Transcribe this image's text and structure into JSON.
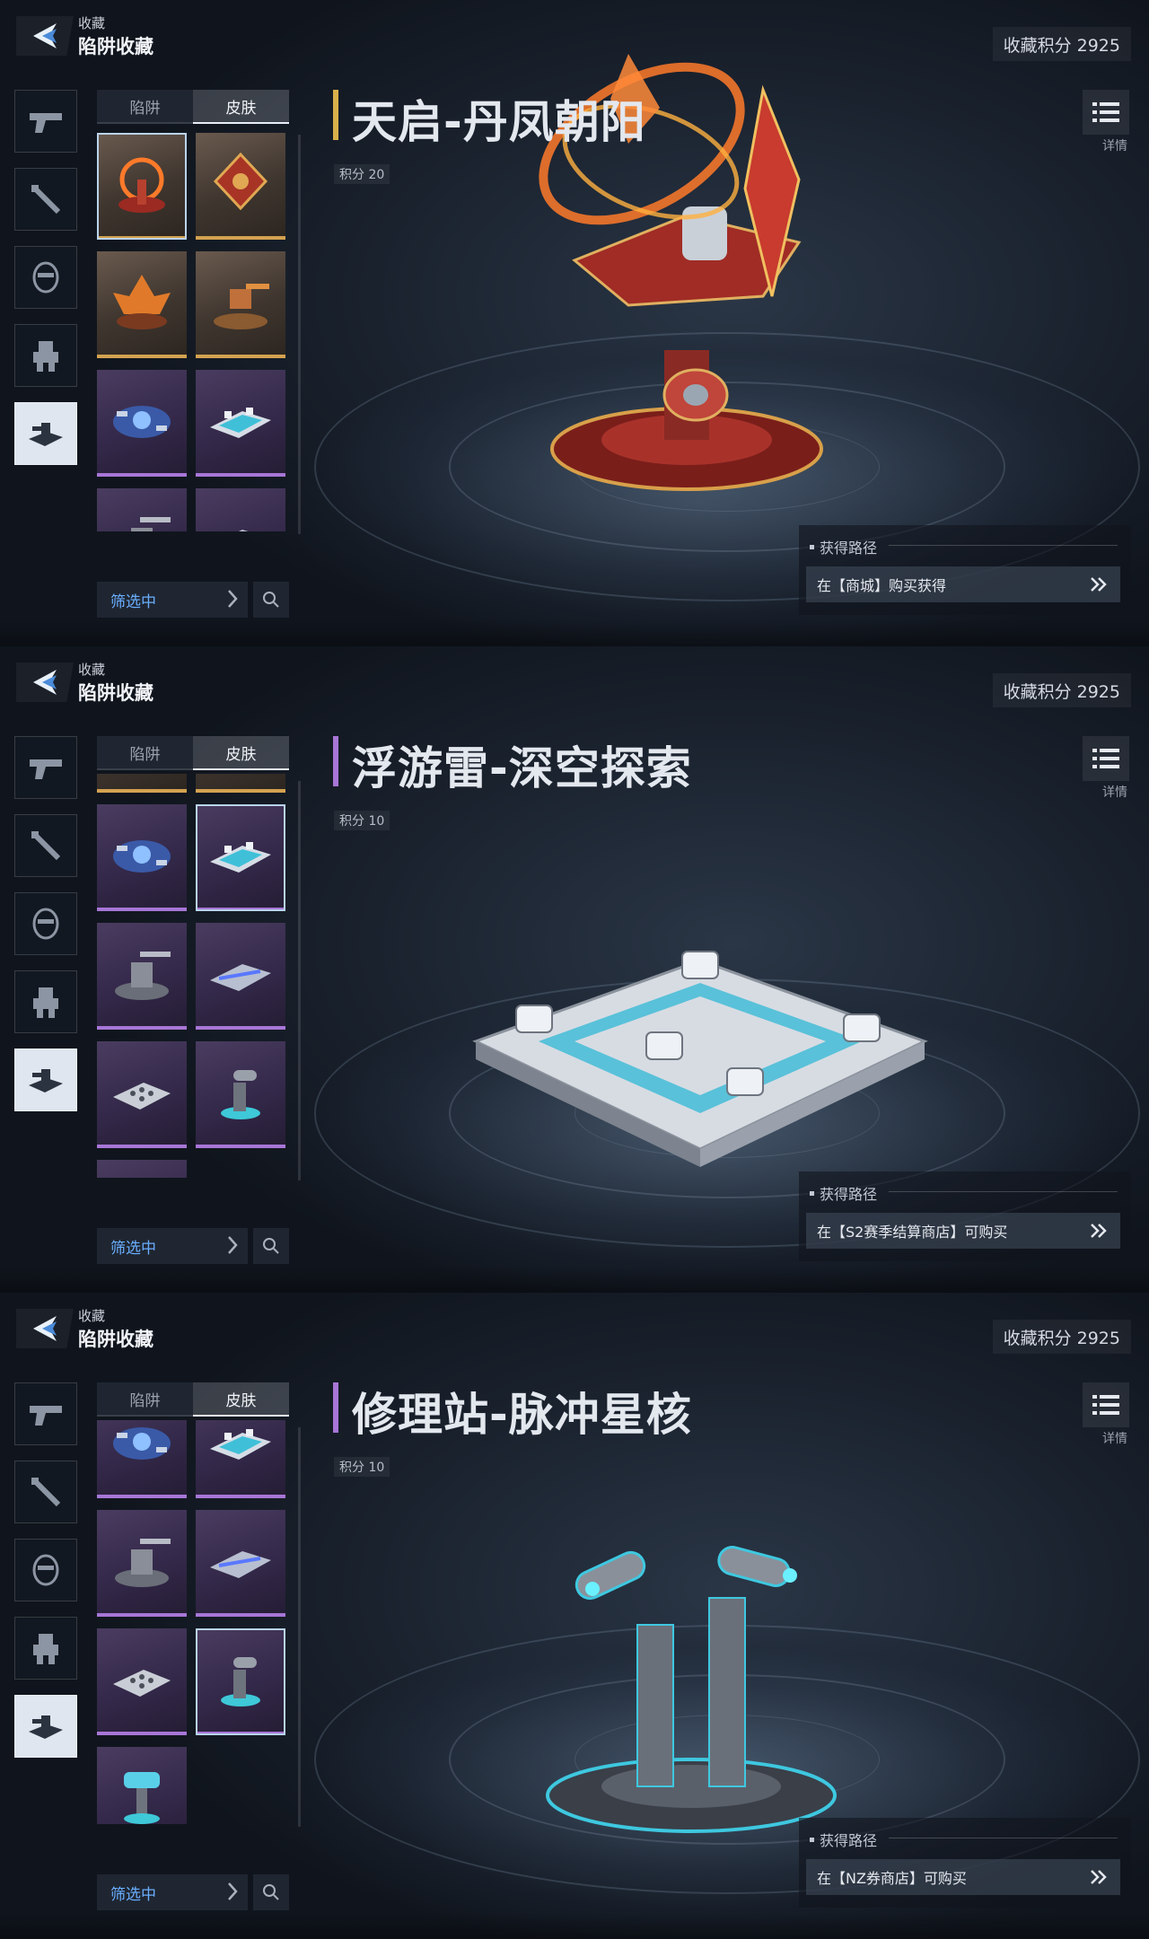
{
  "header": {
    "crumb_small": "收藏",
    "crumb_title": "陷阱收藏",
    "score": "收藏积分 2925"
  },
  "tabs": [
    "陷阱",
    "皮肤"
  ],
  "filter_label": "筛选中",
  "detail_label": "详情",
  "acquire_header": "获得路径",
  "icons": {
    "back": "back-arrow-icon",
    "categories": [
      "pistol-icon",
      "melee-icon",
      "mask-icon",
      "mech-icon",
      "trap-icon"
    ],
    "detail": "list-icon",
    "search": "search-icon",
    "acquire": "double-chevron-icon"
  },
  "colors": {
    "orange_rarity": "#d3a250",
    "purple_rarity": "#a776d6",
    "filter_blue": "#6aaeff"
  },
  "panels": [
    {
      "item_title": "天启-丹凤朝阳",
      "points": "积分 20",
      "acquire_text": "在【商城】购买获得",
      "accent": "#d8b04a"
    },
    {
      "item_title": "浮游雷-深空探索",
      "points": "积分 10",
      "acquire_text": "在【S2赛季结算商店】可购买",
      "accent": "#a776d6"
    },
    {
      "item_title": "修理站-脉冲星核",
      "points": "积分 10",
      "acquire_text": "在【NZ券商店】可购买",
      "accent": "#a776d6"
    }
  ]
}
